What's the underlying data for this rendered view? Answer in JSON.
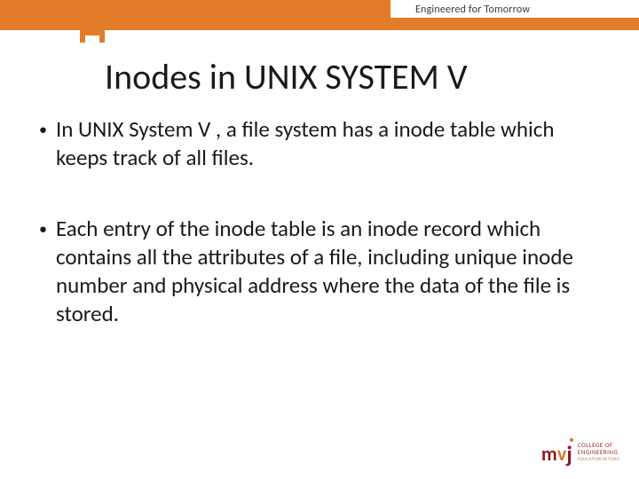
{
  "header": {
    "tagline": "Engineered for Tomorrow"
  },
  "slide": {
    "title": "Inodes in UNIX SYSTEM V",
    "bullets": [
      "In UNIX System V , a file system has a inode table which keeps track of all files.",
      "Each entry of the inode table is an inode record which contains all the attributes of a file, including unique inode number and physical address where the data of the file is stored."
    ]
  },
  "footer": {
    "logo_line1": "COLLEGE OF",
    "logo_line2": "ENGINEERING",
    "logo_sub": "EDUCATION BEYOND"
  }
}
